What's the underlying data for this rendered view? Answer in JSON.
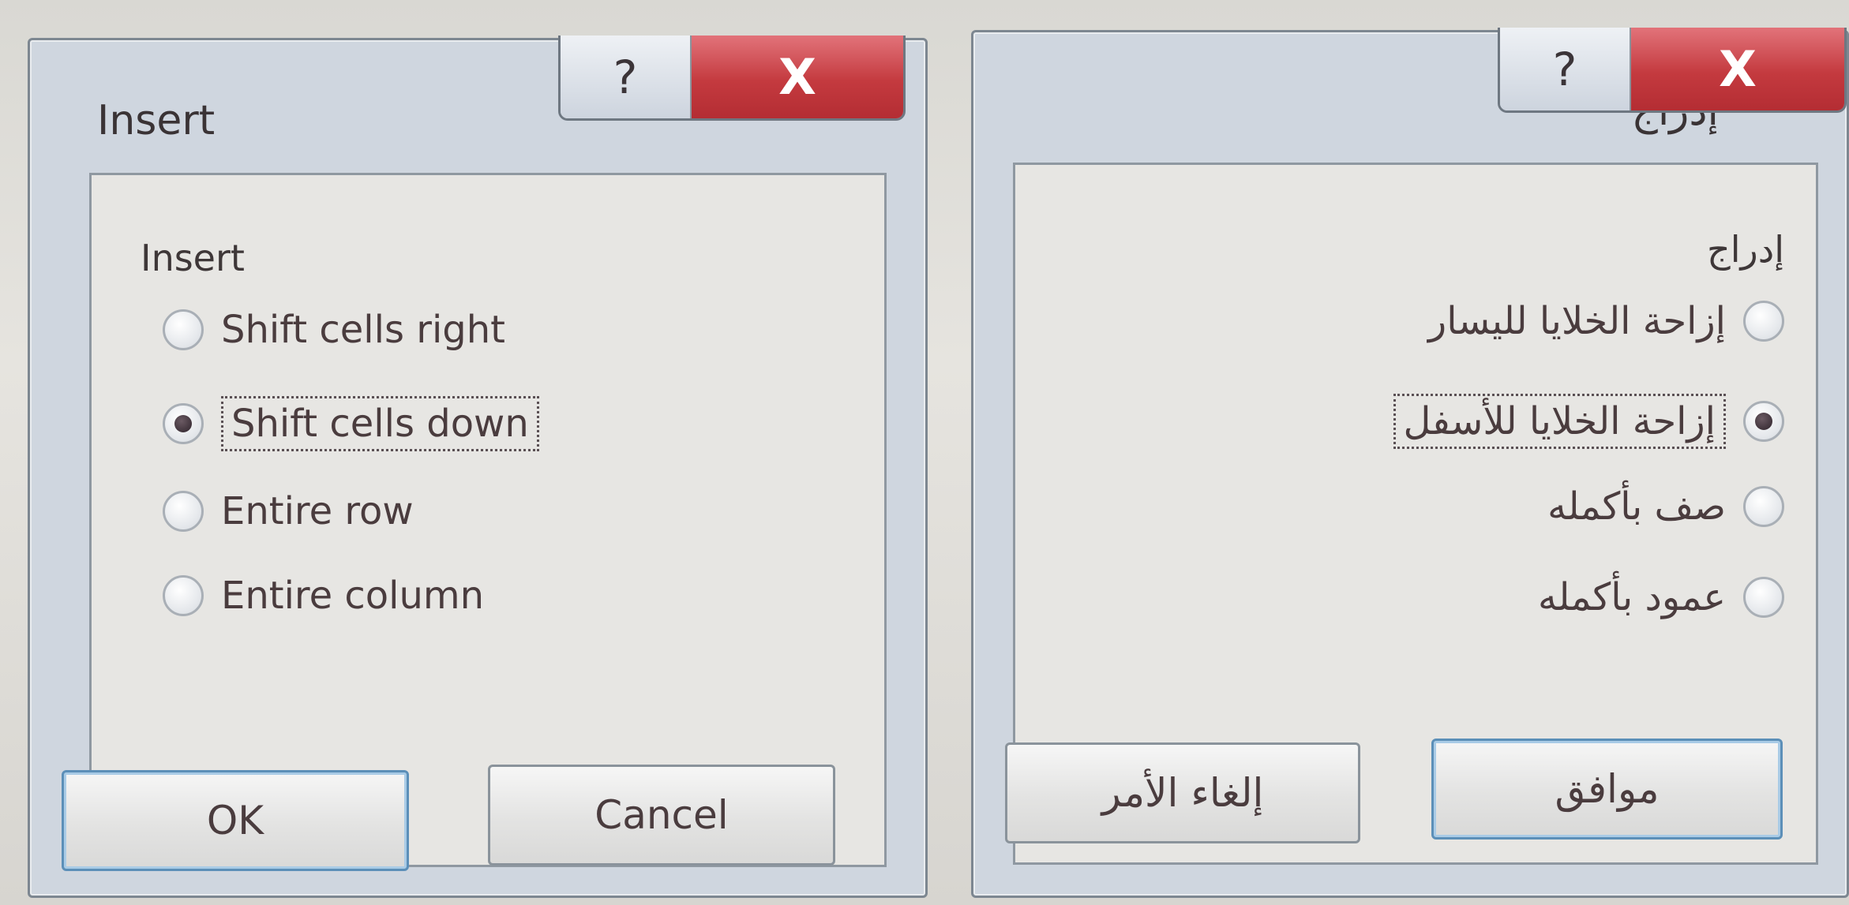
{
  "english_dialog": {
    "title": "Insert",
    "help_glyph": "?",
    "close_glyph": "X",
    "group_label": "Insert",
    "options": [
      {
        "label": "Shift cells right",
        "checked": false
      },
      {
        "label": "Shift cells down",
        "checked": true
      },
      {
        "label": "Entire row",
        "checked": false
      },
      {
        "label": "Entire column",
        "checked": false
      }
    ],
    "ok_label": "OK",
    "cancel_label": "Cancel"
  },
  "arabic_dialog": {
    "title": "إدراج",
    "help_glyph": "?",
    "close_glyph": "X",
    "group_label": "إدراج",
    "options": [
      {
        "label": "إزاحة الخلايا لليسار",
        "checked": false
      },
      {
        "label": "إزاحة الخلايا للأسفل",
        "checked": true
      },
      {
        "label": "صف بأكمله",
        "checked": false
      },
      {
        "label": "عمود بأكمله",
        "checked": false
      }
    ],
    "ok_label": "موافق",
    "cancel_label": "إلغاء الأمر"
  },
  "colors": {
    "close_button": "#c43a3f",
    "default_button_border": "#5c8fb8",
    "frame": "#cfd6df"
  }
}
